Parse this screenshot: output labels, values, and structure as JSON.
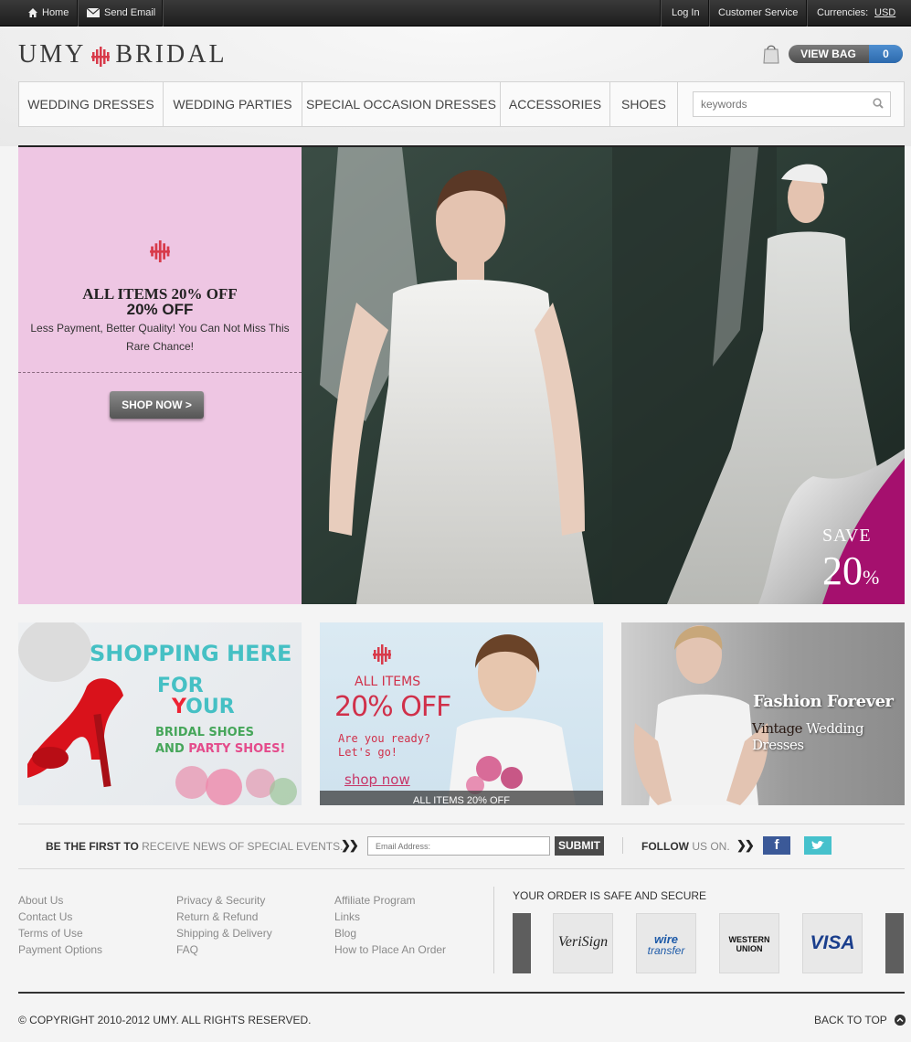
{
  "topbar": {
    "home": "Home",
    "send_email": "Send Email",
    "login": "Log In",
    "customer_service": "Customer Service",
    "currencies_label": "Currencies:",
    "currency": "USD"
  },
  "header": {
    "logo_left": "UMY",
    "logo_right": "BRIDAL",
    "view_bag": "VIEW BAG",
    "bag_count": "0"
  },
  "nav": {
    "items": [
      "WEDDING DRESSES",
      "WEDDING PARTIES",
      "SPECIAL OCCASION DRESSES",
      "ACCESSORIES",
      "SHOES"
    ],
    "search_placeholder": "keywords"
  },
  "hero": {
    "title": "ALL ITEMS 20% OFF",
    "subtitle": "20% OFF",
    "description": "Less Payment, Better Quality! You Can Not Miss This Rare Chance!",
    "cta": "SHOP NOW >",
    "save_label": "SAVE",
    "save_value": "20",
    "save_unit": "%"
  },
  "banners": {
    "shoes": {
      "line1": "SHOPPING HERE",
      "line2": "FOR",
      "line3_a": "Y",
      "line3_b": "OUR",
      "line4": "BRIDAL SHOES",
      "line5_a": "AND ",
      "line5_b": "PARTY SHOES!"
    },
    "sale": {
      "line1": "ALL ITEMS",
      "line2": "20% OFF",
      "line3": "Are you ready?",
      "line4": "Let's go!",
      "link": "shop now",
      "strip": "ALL ITEMS 20% OFF"
    },
    "vintage": {
      "line1": "Fashion Forever",
      "line2_a": "Vintage",
      "line2_b": " Wedding Dresses"
    }
  },
  "newsletter": {
    "bold": "BE THE FIRST TO",
    "rest": " RECEIVE NEWS OF SPECIAL EVENTS.",
    "email_placeholder": "Email Address:",
    "submit": "SUBMIT",
    "follow_bold": "FOLLOW",
    "follow_rest": " US ON."
  },
  "footer": {
    "col1": [
      "About Us",
      "Contact Us",
      "Terms of Use",
      "Payment Options"
    ],
    "col2": [
      "Privacy & Security",
      "Return & Refund",
      "Shipping & Delivery",
      "FAQ"
    ],
    "col3": [
      "Affiliate Program",
      "Links",
      "Blog",
      "How to Place An Order"
    ],
    "secure_title": "YOUR ORDER IS SAFE AND SECURE",
    "payments": {
      "verisign": "VeriSign",
      "wire_a": "wire",
      "wire_b": "transfer",
      "western_a": "WESTERN",
      "western_b": "UNION",
      "visa": "VISA"
    },
    "copyright": "© COPYRIGHT 2010-2012 UMY. ALL RIGHTS RESERVED.",
    "back_to_top": "BACK TO TOP"
  },
  "colors": {
    "promo_bg": "#eec6e3",
    "accent_blue": "#2c69ad",
    "save_magenta": "#a5106e"
  }
}
